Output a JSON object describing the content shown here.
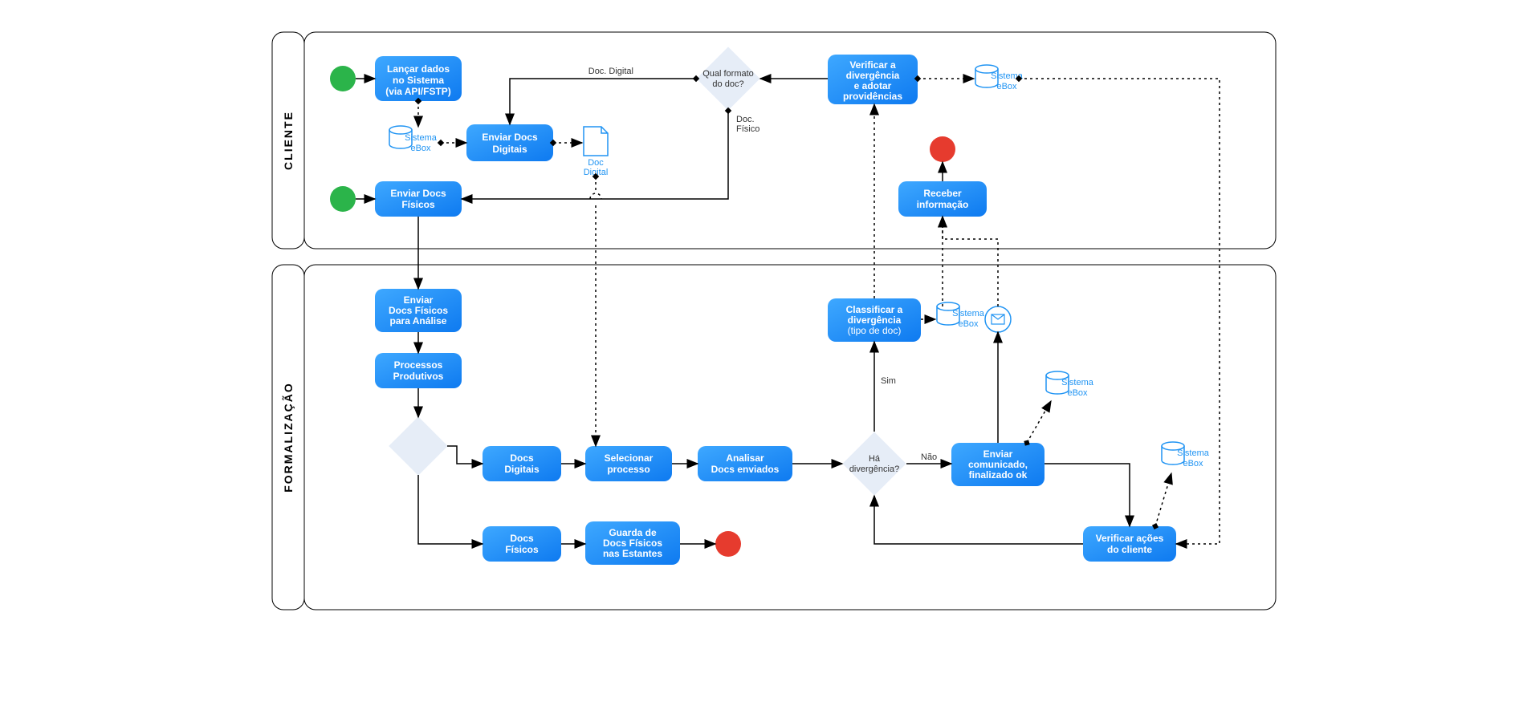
{
  "lanes": {
    "cliente": "CLIENTE",
    "formalizacao": "FORMALIZAÇÃO"
  },
  "tasks": {
    "lancar": "Lançar dados no Sistema (via API/FSTP)",
    "enviarDigitais": "Enviar Docs Digitais",
    "enviarFisicos": "Enviar Docs Físicos",
    "verificarDiv": "Verificar a divergência e adotar providências",
    "receberInfo": "Receber informação",
    "enviarFisAnalise": "Enviar Docs Físicos para Análise",
    "processos": "Processos Produtivos",
    "docsDigitais": "Docs Digitais",
    "docsFisicos": "Docs Físicos",
    "selecionar": "Selecionar processo",
    "analisar": "Analisar Docs enviados",
    "guarda": "Guarda de Docs Físicos nas Estantes",
    "classificar": "Classificar a divergência (tipo de doc)",
    "enviarCom": "Enviar comunicado, finalizado ok",
    "verificarAcoes": "Verificar ações do cliente"
  },
  "gateways": {
    "formato": "Qual formato do doc?",
    "diverg": "Há divergência?"
  },
  "edgeLabels": {
    "docDigital": "Doc. Digital",
    "docFisico": "Doc. Físico",
    "sim": "Sim",
    "nao": "Não"
  },
  "dataObjects": {
    "docDigitalObj": "Doc Digital",
    "sistemaEbox": "Sistema eBox"
  }
}
